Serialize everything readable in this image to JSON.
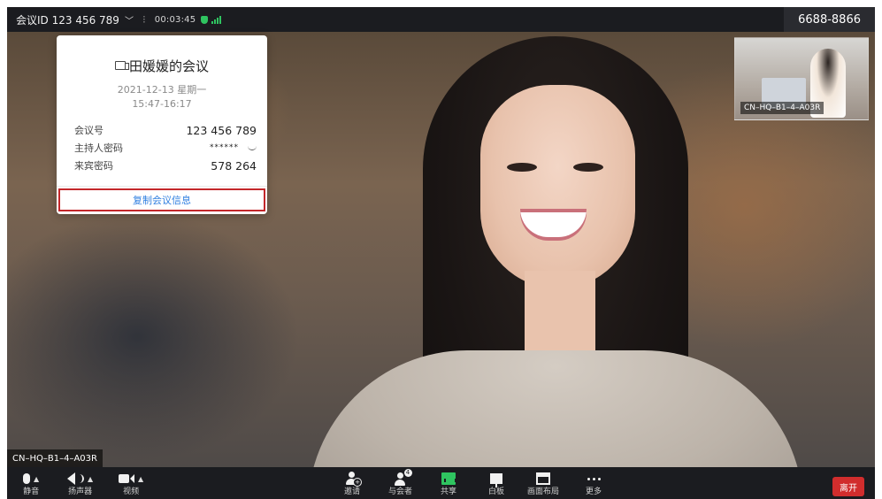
{
  "topbar": {
    "meeting_id_label": "会议ID 123 456 789",
    "timer": "00:03:45",
    "right_id": "6688-8866"
  },
  "video": {
    "main_camera_label": "CN–HQ–B1–4–A03R",
    "pip_camera_label": "CN–HQ–B1–4–A03R"
  },
  "info_panel": {
    "title": "田媛媛的会议",
    "date": "2021-12-13 星期一",
    "time_range": "15:47-16:17",
    "rows": [
      {
        "label": "会议号",
        "value": "123 456 789"
      },
      {
        "label": "主持人密码",
        "value": "******"
      },
      {
        "label": "来宾密码",
        "value": "578 264"
      }
    ],
    "copy_button": "复制会议信息"
  },
  "toolbar": {
    "mute": "静音",
    "speaker": "扬声器",
    "video": "视频",
    "invite": "邀请",
    "participants": "与会者",
    "participants_count": "4",
    "share": "共享",
    "whiteboard": "白板",
    "layout": "画面布局",
    "more": "更多",
    "leave": "离开"
  },
  "icons": {
    "shield": "shield-icon",
    "signal": "signal-icon",
    "mic": "mic-icon",
    "speaker": "speaker-icon",
    "camera": "camera-icon",
    "invite": "add-user-icon",
    "participants": "participants-icon",
    "share": "share-screen-icon",
    "whiteboard": "whiteboard-icon",
    "layout": "layout-icon",
    "more": "more-icon",
    "eye": "eye-closed-icon"
  },
  "colors": {
    "leave": "#d12d2d",
    "share": "#2fc460",
    "copy_link": "#2f7fe0",
    "highlight_border": "#c3272b"
  }
}
